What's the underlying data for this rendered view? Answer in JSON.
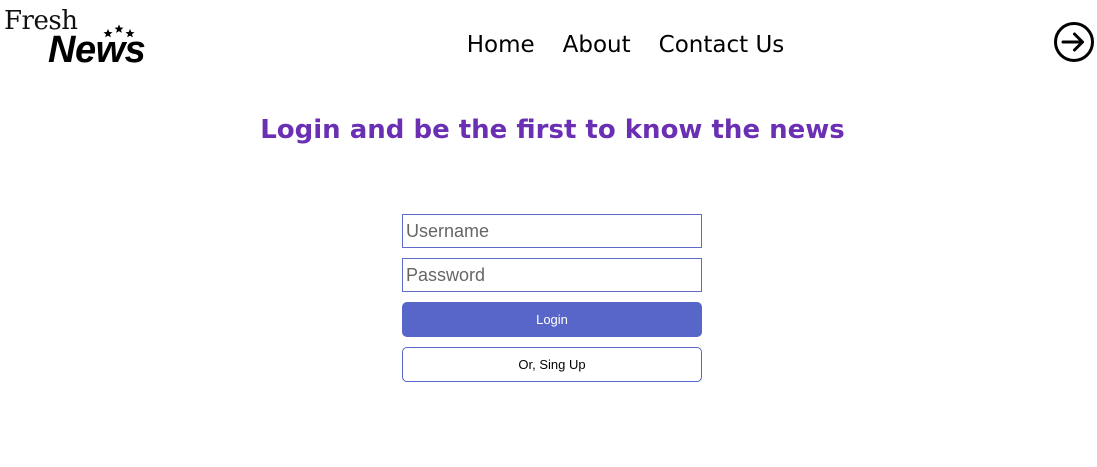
{
  "logo": {
    "line1": "Fresh",
    "line2": "News",
    "icon": "three-stars-icon"
  },
  "nav": {
    "items": [
      {
        "label": "Home"
      },
      {
        "label": "About"
      },
      {
        "label": "Contact Us"
      }
    ]
  },
  "header_actions": {
    "login_icon": "sign-in-arrow-icon"
  },
  "main": {
    "headline": "Login and be the first to know the news"
  },
  "login_form": {
    "username": {
      "value": "",
      "placeholder": "Username"
    },
    "password": {
      "value": "",
      "placeholder": "Password"
    },
    "login_label": "Login",
    "signup_label": "Or, Sing Up"
  },
  "colors": {
    "headline": "#6a2fb2",
    "accent": "#5766c8",
    "field_border": "#5e6cc8",
    "background": "#ffffff"
  }
}
